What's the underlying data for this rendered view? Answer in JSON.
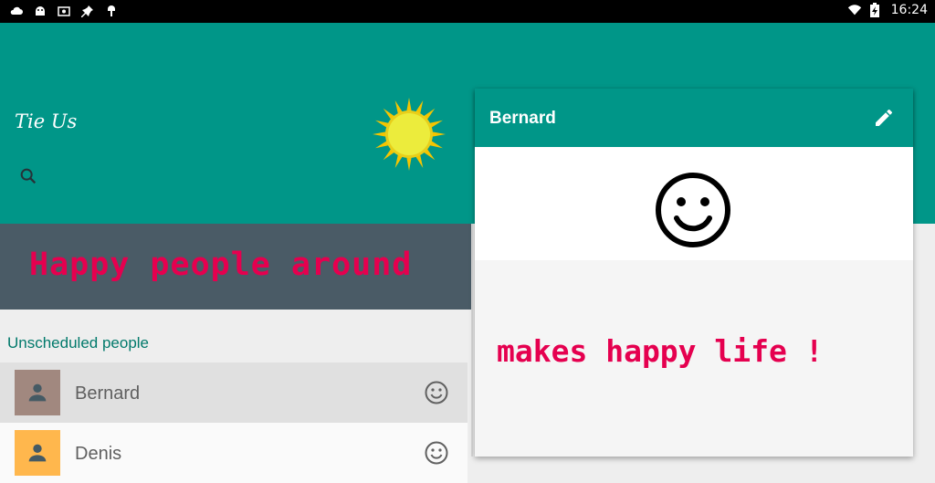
{
  "status_bar": {
    "time": "16:24",
    "notification_icons": [
      "cloud-icon",
      "android-icon",
      "photo-icon",
      "pin-icon",
      "android-debug-icon"
    ],
    "system_icons": [
      "wifi-icon",
      "battery-charging-icon"
    ]
  },
  "app": {
    "title": "Tie Us",
    "accent_color": "#009688"
  },
  "banner": {
    "text": "Happy people around"
  },
  "list": {
    "section_label": "Unscheduled people",
    "items": [
      {
        "name": "Bernard",
        "avatar_color": "#a1887f",
        "selected": true
      },
      {
        "name": "Denis",
        "avatar_color": "#ffb74d",
        "selected": false
      }
    ]
  },
  "detail": {
    "title": "Bernard",
    "caption": "makes happy life !"
  }
}
